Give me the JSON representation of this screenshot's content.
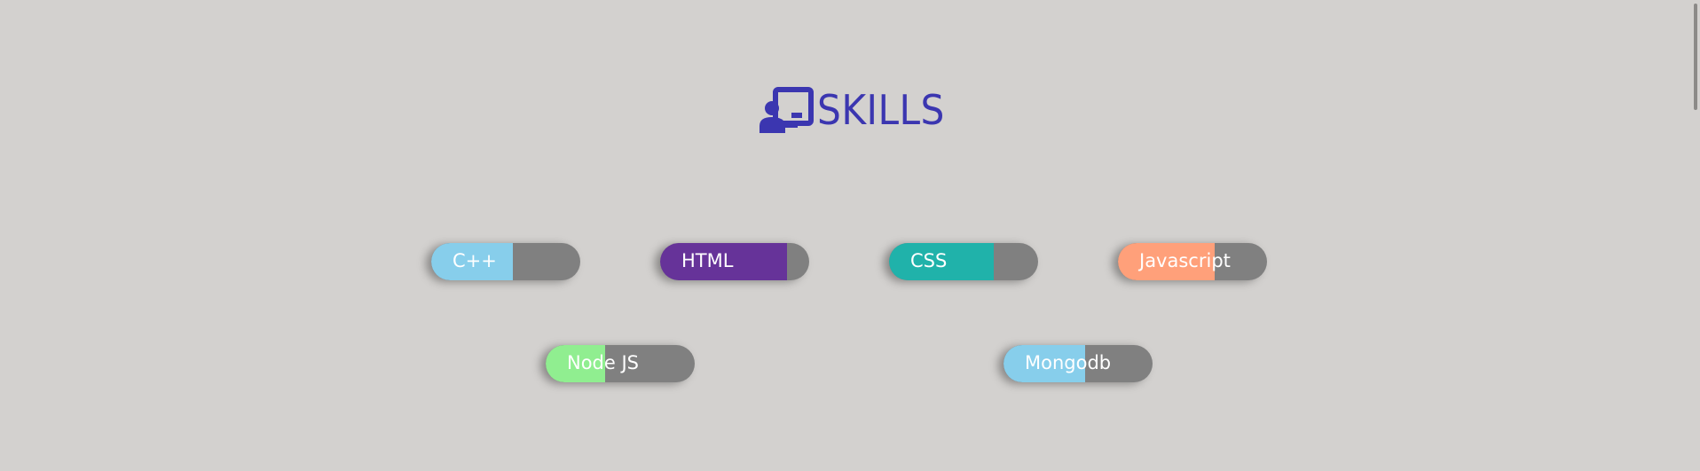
{
  "heading": {
    "title": "SKILLS",
    "icon": "chalkboard-teacher-icon"
  },
  "colors": {
    "heading": "#3b36b0",
    "track": "#808080",
    "label": "#ffffff"
  },
  "skills": [
    {
      "label": "C++",
      "level": 0.55,
      "color": "#87ceeb"
    },
    {
      "label": "HTML",
      "level": 0.85,
      "color": "#663399"
    },
    {
      "label": "CSS",
      "level": 0.7,
      "color": "#20b2aa"
    },
    {
      "label": "Javascript",
      "level": 0.65,
      "color": "#ffa07a"
    },
    {
      "label": "Node JS",
      "level": 0.4,
      "color": "#90ee90"
    },
    {
      "label": "Mongodb",
      "level": 0.55,
      "color": "#87ceeb"
    }
  ]
}
